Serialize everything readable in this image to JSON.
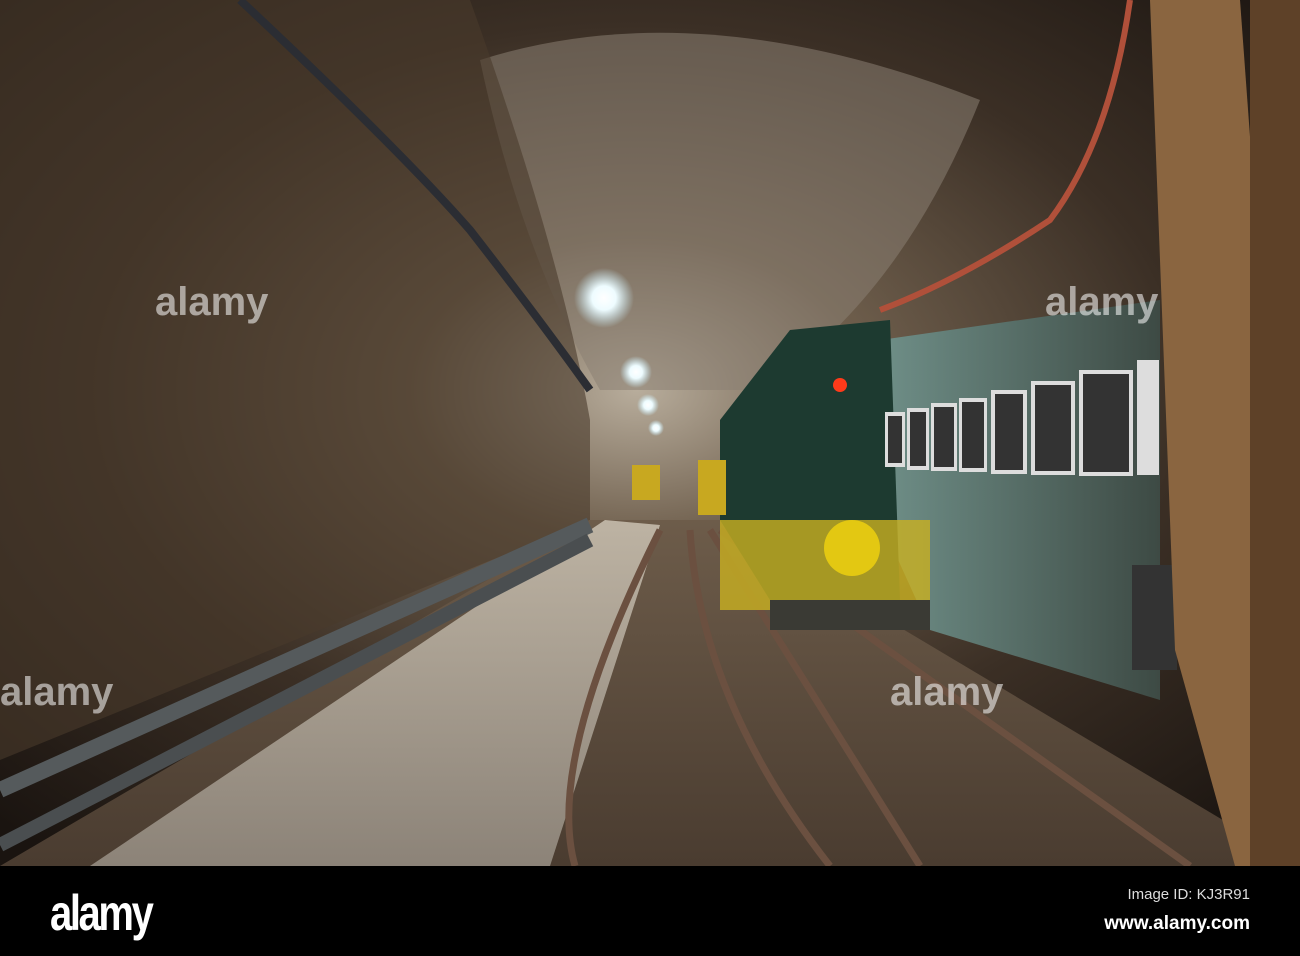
{
  "photo": {
    "subject": "Underground mine tunnel with rail tracks and train",
    "watermark": "alamy"
  },
  "footer": {
    "logo": "alamy",
    "image_id": "Image ID: KJ3R91",
    "website": "www.alamy.com"
  }
}
